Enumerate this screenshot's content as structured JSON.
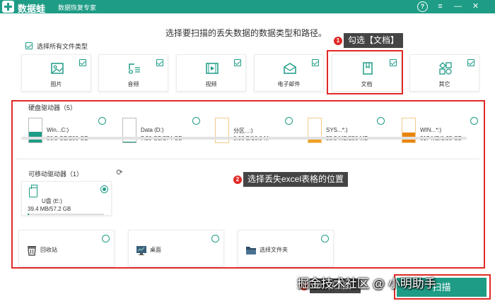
{
  "app": {
    "name": "数据蛙",
    "subtitle": "数据恢复专家"
  },
  "window_controls": {
    "help": "?",
    "menu": "≡",
    "minimize": "—",
    "close": "✕"
  },
  "instruction": "选择要扫描的丢失数据的数据类型和路径。",
  "select_all": {
    "label": "选择所有文件类型",
    "checked": true
  },
  "file_types": [
    {
      "label": "图片",
      "icon": "image-icon",
      "checked": true
    },
    {
      "label": "音频",
      "icon": "music-icon",
      "checked": true
    },
    {
      "label": "视频",
      "icon": "video-icon",
      "checked": true
    },
    {
      "label": "电子邮件",
      "icon": "email-icon",
      "checked": true
    },
    {
      "label": "文档",
      "icon": "document-icon",
      "checked": true
    },
    {
      "label": "其它",
      "icon": "apps-icon",
      "checked": true
    }
  ],
  "callouts": {
    "step1": {
      "number": "1",
      "text": "勾选【文档】"
    },
    "step2": {
      "number": "2",
      "text": "选择丢失excel表格的位置"
    },
    "step3": {
      "number": "3",
      "text": "单【扫描】"
    }
  },
  "hard_drives": {
    "title": "硬盘驱动器（5）",
    "items": [
      {
        "name": "Win...C:)",
        "size": "86.5 GB/200 GB",
        "usage": 0.43,
        "color": "#1e9c86"
      },
      {
        "name": "Data (D:)",
        "size": "7.20 GB/274 GB",
        "usage": 0.03,
        "color": "#1e9c86"
      },
      {
        "name": "分区...:)",
        "size": "0.00  B/16.0 M",
        "usage": 0.0,
        "color": "#f0a020"
      },
      {
        "name": "SYS...*:)",
        "size": "35.5 MB/256 MB",
        "usage": 0.14,
        "color": "#f0a020"
      },
      {
        "name": "WIN...*:)",
        "size": "817 MB/1.95 GB",
        "usage": 0.42,
        "color": "#e8850e"
      }
    ]
  },
  "removable_drives": {
    "title": "可移动驱动器（1）",
    "items": [
      {
        "name": "U盘 (E:)",
        "size": "39.4 MB/57.2 GB",
        "usage": 0.001,
        "selected": true
      }
    ]
  },
  "locations": [
    {
      "label": "回收站",
      "icon": "recycle-bin-icon"
    },
    {
      "label": "桌面",
      "icon": "desktop-icon"
    },
    {
      "label": "选择文件夹",
      "icon": "folder-icon"
    }
  ],
  "watermark": "掘金技术社区 @ 小明助手",
  "scan_button": "扫描",
  "colors": {
    "brand": "#1e9c86",
    "highlight": "#e02a26",
    "orange": "#f0a020"
  }
}
